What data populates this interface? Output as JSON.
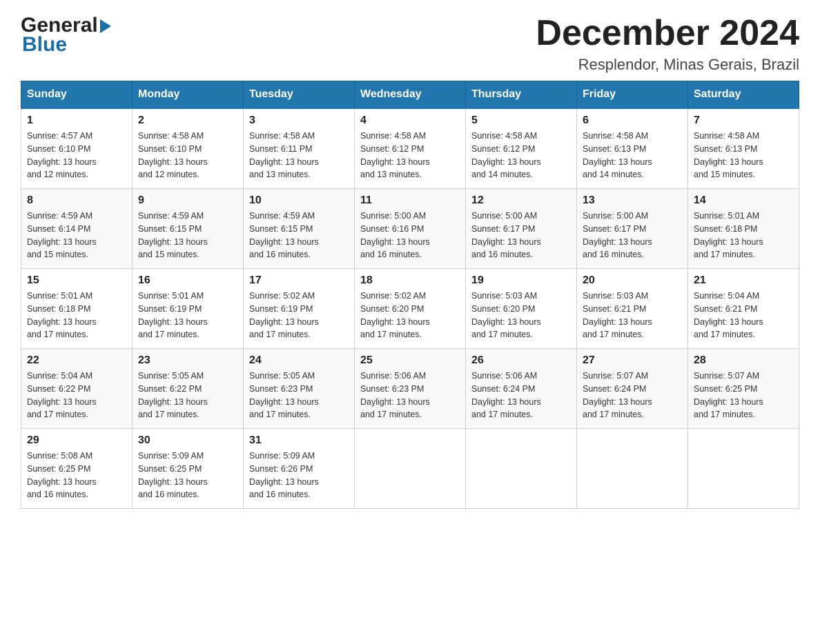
{
  "header": {
    "logo_general": "General",
    "logo_blue": "Blue",
    "month_title": "December 2024",
    "subtitle": "Resplendor, Minas Gerais, Brazil"
  },
  "weekdays": [
    "Sunday",
    "Monday",
    "Tuesday",
    "Wednesday",
    "Thursday",
    "Friday",
    "Saturday"
  ],
  "weeks": [
    [
      {
        "day": "1",
        "sunrise": "4:57 AM",
        "sunset": "6:10 PM",
        "daylight": "13 hours and 12 minutes."
      },
      {
        "day": "2",
        "sunrise": "4:58 AM",
        "sunset": "6:10 PM",
        "daylight": "13 hours and 12 minutes."
      },
      {
        "day": "3",
        "sunrise": "4:58 AM",
        "sunset": "6:11 PM",
        "daylight": "13 hours and 13 minutes."
      },
      {
        "day": "4",
        "sunrise": "4:58 AM",
        "sunset": "6:12 PM",
        "daylight": "13 hours and 13 minutes."
      },
      {
        "day": "5",
        "sunrise": "4:58 AM",
        "sunset": "6:12 PM",
        "daylight": "13 hours and 14 minutes."
      },
      {
        "day": "6",
        "sunrise": "4:58 AM",
        "sunset": "6:13 PM",
        "daylight": "13 hours and 14 minutes."
      },
      {
        "day": "7",
        "sunrise": "4:58 AM",
        "sunset": "6:13 PM",
        "daylight": "13 hours and 15 minutes."
      }
    ],
    [
      {
        "day": "8",
        "sunrise": "4:59 AM",
        "sunset": "6:14 PM",
        "daylight": "13 hours and 15 minutes."
      },
      {
        "day": "9",
        "sunrise": "4:59 AM",
        "sunset": "6:15 PM",
        "daylight": "13 hours and 15 minutes."
      },
      {
        "day": "10",
        "sunrise": "4:59 AM",
        "sunset": "6:15 PM",
        "daylight": "13 hours and 16 minutes."
      },
      {
        "day": "11",
        "sunrise": "5:00 AM",
        "sunset": "6:16 PM",
        "daylight": "13 hours and 16 minutes."
      },
      {
        "day": "12",
        "sunrise": "5:00 AM",
        "sunset": "6:17 PM",
        "daylight": "13 hours and 16 minutes."
      },
      {
        "day": "13",
        "sunrise": "5:00 AM",
        "sunset": "6:17 PM",
        "daylight": "13 hours and 16 minutes."
      },
      {
        "day": "14",
        "sunrise": "5:01 AM",
        "sunset": "6:18 PM",
        "daylight": "13 hours and 17 minutes."
      }
    ],
    [
      {
        "day": "15",
        "sunrise": "5:01 AM",
        "sunset": "6:18 PM",
        "daylight": "13 hours and 17 minutes."
      },
      {
        "day": "16",
        "sunrise": "5:01 AM",
        "sunset": "6:19 PM",
        "daylight": "13 hours and 17 minutes."
      },
      {
        "day": "17",
        "sunrise": "5:02 AM",
        "sunset": "6:19 PM",
        "daylight": "13 hours and 17 minutes."
      },
      {
        "day": "18",
        "sunrise": "5:02 AM",
        "sunset": "6:20 PM",
        "daylight": "13 hours and 17 minutes."
      },
      {
        "day": "19",
        "sunrise": "5:03 AM",
        "sunset": "6:20 PM",
        "daylight": "13 hours and 17 minutes."
      },
      {
        "day": "20",
        "sunrise": "5:03 AM",
        "sunset": "6:21 PM",
        "daylight": "13 hours and 17 minutes."
      },
      {
        "day": "21",
        "sunrise": "5:04 AM",
        "sunset": "6:21 PM",
        "daylight": "13 hours and 17 minutes."
      }
    ],
    [
      {
        "day": "22",
        "sunrise": "5:04 AM",
        "sunset": "6:22 PM",
        "daylight": "13 hours and 17 minutes."
      },
      {
        "day": "23",
        "sunrise": "5:05 AM",
        "sunset": "6:22 PM",
        "daylight": "13 hours and 17 minutes."
      },
      {
        "day": "24",
        "sunrise": "5:05 AM",
        "sunset": "6:23 PM",
        "daylight": "13 hours and 17 minutes."
      },
      {
        "day": "25",
        "sunrise": "5:06 AM",
        "sunset": "6:23 PM",
        "daylight": "13 hours and 17 minutes."
      },
      {
        "day": "26",
        "sunrise": "5:06 AM",
        "sunset": "6:24 PM",
        "daylight": "13 hours and 17 minutes."
      },
      {
        "day": "27",
        "sunrise": "5:07 AM",
        "sunset": "6:24 PM",
        "daylight": "13 hours and 17 minutes."
      },
      {
        "day": "28",
        "sunrise": "5:07 AM",
        "sunset": "6:25 PM",
        "daylight": "13 hours and 17 minutes."
      }
    ],
    [
      {
        "day": "29",
        "sunrise": "5:08 AM",
        "sunset": "6:25 PM",
        "daylight": "13 hours and 16 minutes."
      },
      {
        "day": "30",
        "sunrise": "5:09 AM",
        "sunset": "6:25 PM",
        "daylight": "13 hours and 16 minutes."
      },
      {
        "day": "31",
        "sunrise": "5:09 AM",
        "sunset": "6:26 PM",
        "daylight": "13 hours and 16 minutes."
      },
      null,
      null,
      null,
      null
    ]
  ],
  "labels": {
    "sunrise": "Sunrise:",
    "sunset": "Sunset:",
    "daylight": "Daylight:"
  }
}
